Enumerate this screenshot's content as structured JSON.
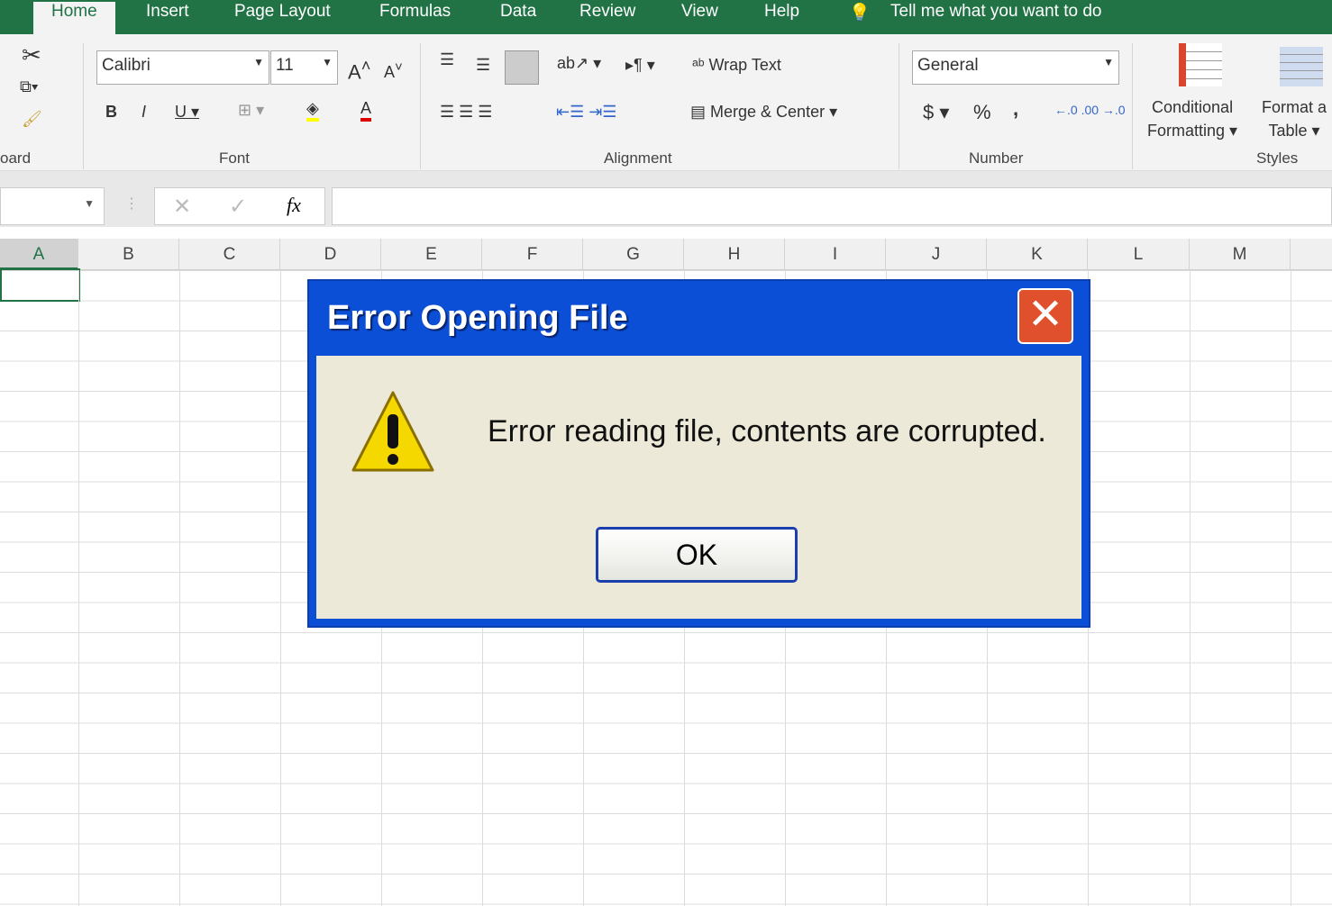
{
  "ribbon_tabs": [
    "Home",
    "Insert",
    "Page Layout",
    "Formulas",
    "Data",
    "Review",
    "View",
    "Help"
  ],
  "tell_me": "Tell me what you want to do",
  "font": {
    "name": "Calibri",
    "size": "11",
    "group": "Font"
  },
  "clipboard_group": "oard",
  "alignment": {
    "wrap": "Wrap Text",
    "merge": "Merge & Center",
    "group": "Alignment"
  },
  "number": {
    "format": "General",
    "group": "Number",
    "currency": "$",
    "percent": "%",
    "comma": ","
  },
  "styles": {
    "conditional1": "Conditional",
    "conditional2": "Formatting",
    "format1": "Format a",
    "format2": "Table",
    "group": "Styles"
  },
  "formula_bar": {
    "fx": "fx",
    "value": ""
  },
  "columns": [
    "A",
    "B",
    "C",
    "D",
    "E",
    "F",
    "G",
    "H",
    "I",
    "J",
    "K",
    "L",
    "M"
  ],
  "dialog": {
    "title": "Error Opening File",
    "message": "Error reading file, contents are corrupted.",
    "ok": "OK",
    "close": "✕"
  },
  "colors": {
    "excel_green": "#217346",
    "dialog_blue": "#0b4fd6",
    "dialog_body": "#ece9d8"
  }
}
